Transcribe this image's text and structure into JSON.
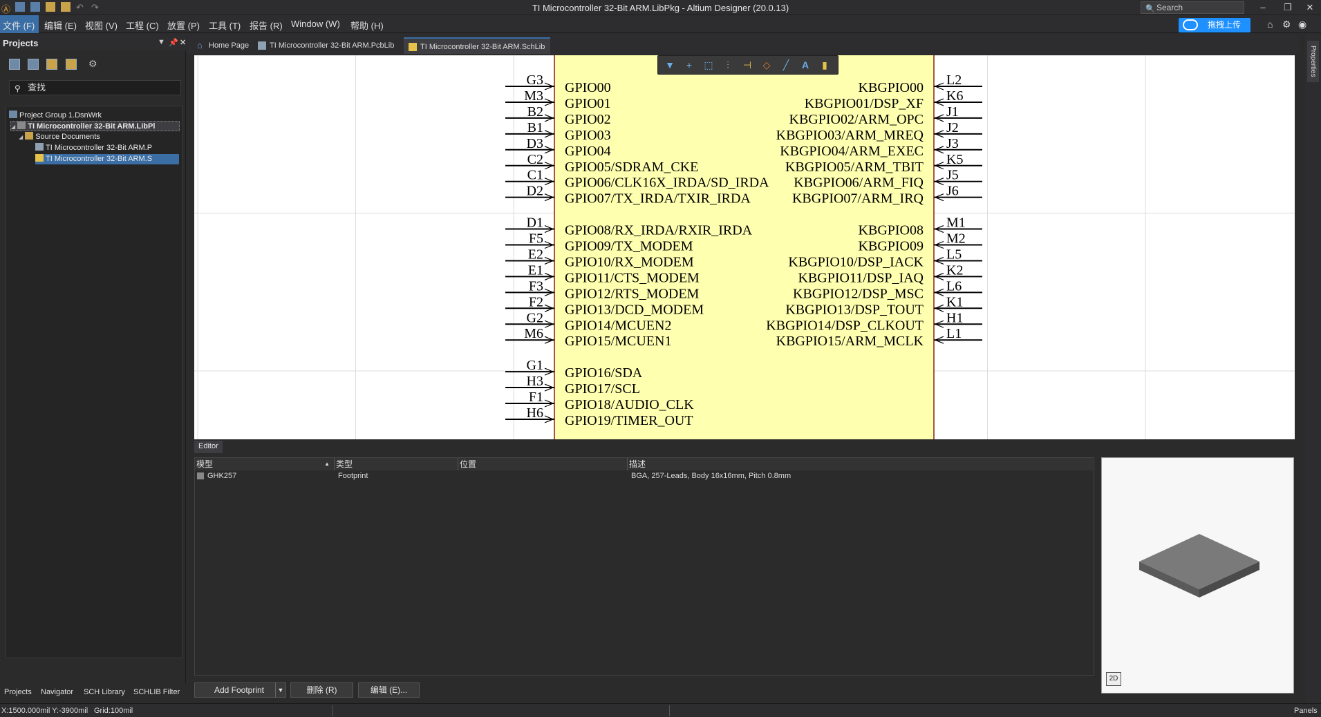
{
  "window": {
    "title": "TI Microcontroller 32-Bit ARM.LibPkg - Altium Designer (20.0.13)",
    "search_label": "Search"
  },
  "menu": [
    "文件 (F)",
    "编辑 (E)",
    "视图 (V)",
    "工程 (C)",
    "放置 (P)",
    "工具 (T)",
    "报告 (R)",
    "Window (W)",
    "帮助 (H)"
  ],
  "cloud_button": "拖拽上传",
  "projects_panel": {
    "title": "Projects",
    "search_placeholder": "查找",
    "tree": [
      {
        "label": "Project Group 1.DsnWrk",
        "icon": "workspace-icon"
      },
      {
        "label": "TI Microcontroller 32-Bit ARM.LibPl",
        "icon": "libpkg-icon"
      },
      {
        "label": "Source Documents",
        "icon": "folder-icon"
      },
      {
        "label": "TI Microcontroller 32-Bit ARM.P",
        "icon": "pcblib-icon"
      },
      {
        "label": "TI Microcontroller 32-Bit ARM.S",
        "icon": "schlib-icon"
      }
    ],
    "bottom_tabs": [
      "Projects",
      "Navigator",
      "SCH Library",
      "SCHLIB Filter"
    ]
  },
  "doc_tabs": [
    "Home Page",
    "TI Microcontroller 32-Bit ARM.PcbLib",
    "TI Microcontroller 32-Bit ARM.SchLib"
  ],
  "schematic": {
    "left_groups": [
      [
        [
          "G3",
          "GPIO00"
        ],
        [
          "M3",
          "GPIO01"
        ],
        [
          "B2",
          "GPIO02"
        ],
        [
          "B1",
          "GPIO03"
        ],
        [
          "D3",
          "GPIO04"
        ],
        [
          "C2",
          "GPIO05/SDRAM_CKE"
        ],
        [
          "C1",
          "GPIO06/CLK16X_IRDA/SD_IRDA"
        ],
        [
          "D2",
          "GPIO07/TX_IRDA/TXIR_IRDA"
        ]
      ],
      [
        [
          "D1",
          "GPIO08/RX_IRDA/RXIR_IRDA"
        ],
        [
          "F5",
          "GPIO09/TX_MODEM"
        ],
        [
          "E2",
          "GPIO10/RX_MODEM"
        ],
        [
          "E1",
          "GPIO11/CTS_MODEM"
        ],
        [
          "F3",
          "GPIO12/RTS_MODEM"
        ],
        [
          "F2",
          "GPIO13/DCD_MODEM"
        ],
        [
          "G2",
          "GPIO14/MCUEN2"
        ],
        [
          "M6",
          "GPIO15/MCUEN1"
        ]
      ],
      [
        [
          "G1",
          "GPIO16/SDA"
        ],
        [
          "H3",
          "GPIO17/SCL"
        ],
        [
          "F1",
          "GPIO18/AUDIO_CLK"
        ],
        [
          "H6",
          "GPIO19/TIMER_OUT"
        ]
      ]
    ],
    "right_groups": [
      [
        [
          "L2",
          "KBGPIO00"
        ],
        [
          "K6",
          "KBGPIO01/DSP_XF"
        ],
        [
          "J1",
          "KBGPIO02/ARM_OPC"
        ],
        [
          "J2",
          "KBGPIO03/ARM_MREQ"
        ],
        [
          "J3",
          "KBGPIO04/ARM_EXEC"
        ],
        [
          "K5",
          "KBGPIO05/ARM_TBIT"
        ],
        [
          "J5",
          "KBGPIO06/ARM_FIQ"
        ],
        [
          "J6",
          "KBGPIO07/ARM_IRQ"
        ]
      ],
      [
        [
          "M1",
          "KBGPIO08"
        ],
        [
          "M2",
          "KBGPIO09"
        ],
        [
          "L5",
          "KBGPIO10/DSP_IACK"
        ],
        [
          "K2",
          "KBGPIO11/DSP_IAQ"
        ],
        [
          "L6",
          "KBGPIO12/DSP_MSC"
        ],
        [
          "K1",
          "KBGPIO13/DSP_TOUT"
        ],
        [
          "H1",
          "KBGPIO14/DSP_CLKOUT"
        ],
        [
          "L1",
          "KBGPIO15/ARM_MCLK"
        ]
      ]
    ],
    "body_color": "#ffffb0",
    "border_color": "#8b1a1a"
  },
  "editor": {
    "tab": "Editor",
    "columns": [
      "模型",
      "类型",
      "位置",
      "描述"
    ],
    "rows": [
      {
        "model": "GHK257",
        "type": "Footprint",
        "location": "",
        "description": "BGA, 257-Leads, Body 16x16mm, Pitch 0.8mm"
      }
    ],
    "buttons": {
      "add": "Add Footprint",
      "delete": "删除 (R)",
      "edit": "编辑 (E)..."
    },
    "preview_mode": "2D"
  },
  "right_panel_tab": "Properties",
  "status": {
    "coords": "X:1500.000mil Y:-3900mil",
    "grid": "Grid:100mil",
    "panels": "Panels"
  }
}
